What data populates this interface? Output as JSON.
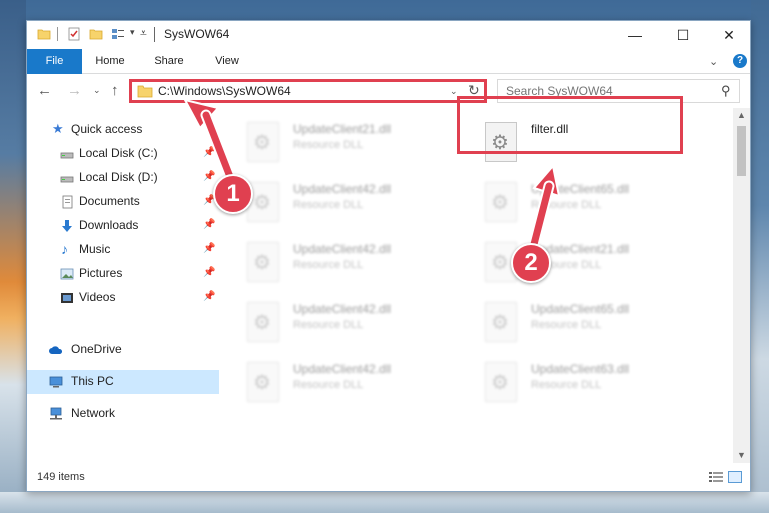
{
  "window": {
    "title": "SysWOW64",
    "controls": {
      "minimize": "—",
      "maximize": "☐",
      "close": "✕"
    }
  },
  "ribbon": {
    "tabs": [
      {
        "label": "File"
      },
      {
        "label": "Home"
      },
      {
        "label": "Share"
      },
      {
        "label": "View"
      }
    ],
    "help": "?"
  },
  "navigation": {
    "address": "C:\\Windows\\SysWOW64",
    "search_placeholder": "Search SysWOW64"
  },
  "sidebar": {
    "items": [
      {
        "label": "Quick access",
        "icon": "star-icon"
      },
      {
        "label": "Local Disk (C:)",
        "icon": "drive-icon",
        "pinned": true
      },
      {
        "label": "Local Disk (D:)",
        "icon": "drive-icon",
        "pinned": true
      },
      {
        "label": "Documents",
        "icon": "documents-icon",
        "pinned": true
      },
      {
        "label": "Downloads",
        "icon": "download-icon",
        "pinned": true
      },
      {
        "label": "Music",
        "icon": "music-icon",
        "pinned": true
      },
      {
        "label": "Pictures",
        "icon": "pictures-icon",
        "pinned": true
      },
      {
        "label": "Videos",
        "icon": "videos-icon",
        "pinned": true
      },
      {
        "label": "OneDrive",
        "icon": "cloud-icon"
      },
      {
        "label": "This PC",
        "icon": "computer-icon",
        "selected": true
      },
      {
        "label": "Network",
        "icon": "network-icon"
      }
    ]
  },
  "files": [
    {
      "name": "UpdateClient21.dll",
      "type": "Resource DLL",
      "blurred": true
    },
    {
      "name": "filter.dll",
      "type": "",
      "blurred": false
    },
    {
      "name": "UpdateClient42.dll",
      "type": "Resource DLL",
      "blurred": true
    },
    {
      "name": "UpdateClient65.dll",
      "type": "Resource DLL",
      "blurred": true
    },
    {
      "name": "UpdateClient42.dll",
      "type": "Resource DLL",
      "blurred": true
    },
    {
      "name": "UpdateClient21.dll",
      "type": "Resource DLL",
      "blurred": true
    },
    {
      "name": "UpdateClient42.dll",
      "type": "Resource DLL",
      "blurred": true
    },
    {
      "name": "UpdateClient65.dll",
      "type": "Resource DLL",
      "blurred": true
    },
    {
      "name": "UpdateClient42.dll",
      "type": "Resource DLL",
      "blurred": true
    },
    {
      "name": "UpdateClient63.dll",
      "type": "Resource DLL",
      "blurred": true
    }
  ],
  "status": {
    "item_count": "149 items"
  },
  "annotations": {
    "step1": "1",
    "step2": "2",
    "color": "#e04050"
  }
}
